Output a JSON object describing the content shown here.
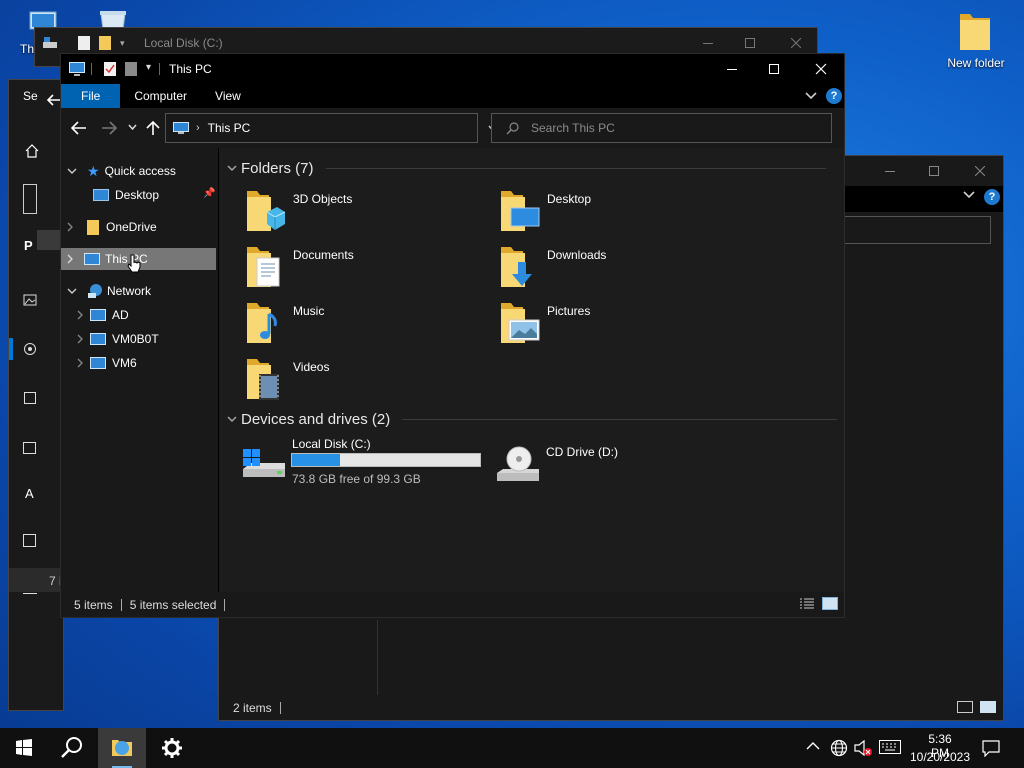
{
  "desktop": {
    "icons": [
      {
        "label": "Thi"
      },
      {
        "label": "New folder"
      }
    ]
  },
  "back_window": {
    "title": "Local Disk (C:)",
    "status": "7 i"
  },
  "left_partial": {
    "letters": [
      "Se",
      "F",
      "P",
      "A"
    ]
  },
  "right_window": {
    "status_items": "2 items"
  },
  "main": {
    "title": "This PC",
    "ribbon_tabs": [
      "File",
      "Computer",
      "View"
    ],
    "help_label": "?",
    "address": "This PC",
    "search_placeholder": "Search This PC",
    "nav": {
      "quick_access": "Quick access",
      "desktop": "Desktop",
      "onedrive": "OneDrive",
      "this_pc": "This PC",
      "network": "Network",
      "network_items": [
        "AD",
        "VM0B0T",
        "VM6"
      ]
    },
    "folders_header": "Folders (7)",
    "folders": [
      "3D Objects",
      "Desktop",
      "Documents",
      "Downloads",
      "Music",
      "Pictures",
      "Videos"
    ],
    "drives_header": "Devices and drives (2)",
    "drives": [
      {
        "name": "Local Disk (C:)",
        "free": "73.8 GB free of 99.3 GB",
        "used_fraction": 0.257
      },
      {
        "name": "CD Drive (D:)"
      }
    ],
    "status_items": "5 items",
    "status_selected": "5 items selected"
  },
  "taskbar": {
    "time": "5:36 PM",
    "date": "10/20/2023"
  },
  "colors": {
    "accent": "#0063b1",
    "folder": "#f3c95a",
    "drive_bar": "#2691e6"
  }
}
